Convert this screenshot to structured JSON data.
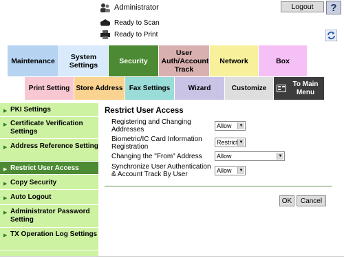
{
  "header": {
    "user": "Administrator",
    "status": [
      "Ready to Scan",
      "Ready to Print"
    ],
    "logout_label": "Logout",
    "help_label": "?"
  },
  "tabs_row1": [
    {
      "label": "Maintenance",
      "color": "#b6d4f2"
    },
    {
      "label": "System Settings",
      "color": "#d8eafb"
    },
    {
      "label": "Security",
      "color": "#4c8a33"
    },
    {
      "label": "User Auth/Account Track",
      "color": "#d9b0b0"
    },
    {
      "label": "Network",
      "color": "#f8f09a"
    },
    {
      "label": "Box",
      "color": "#f5c0f5"
    }
  ],
  "tabs_row2": [
    {
      "label": "Print Setting",
      "color": "#f7c7d2"
    },
    {
      "label": "Store Address",
      "color": "#f9d38f"
    },
    {
      "label": "Fax Settings",
      "color": "#9adcd8"
    },
    {
      "label": "Wizard",
      "color": "#c9c3e6"
    },
    {
      "label": "Customize",
      "color": "#dedede"
    },
    {
      "label": "To Main Menu",
      "color": "#3d3d3d"
    }
  ],
  "nav": [
    "PKI Settings",
    "Certificate Verification Settings",
    "Address Reference Setting",
    "Restrict User Access",
    "Copy Security",
    "Auto Logout",
    "Administrator Password Setting",
    "TX Operation Log Settings"
  ],
  "main": {
    "title": "Restrict User Access",
    "rows": [
      {
        "label": "Registering and Changing Addresses",
        "value": "Allow"
      },
      {
        "label": "Biometric/IC Card Information Registration",
        "value": "Restrict"
      },
      {
        "label": "Changing the \"From\" Address",
        "value": "Allow"
      },
      {
        "label": "Synchronize User Authentication & Account Track By User",
        "value": "Allow"
      }
    ],
    "ok_label": "OK",
    "cancel_label": "Cancel"
  },
  "colors": {
    "accent": "#4c8a33",
    "nav_bg": "#cdf2a2"
  }
}
